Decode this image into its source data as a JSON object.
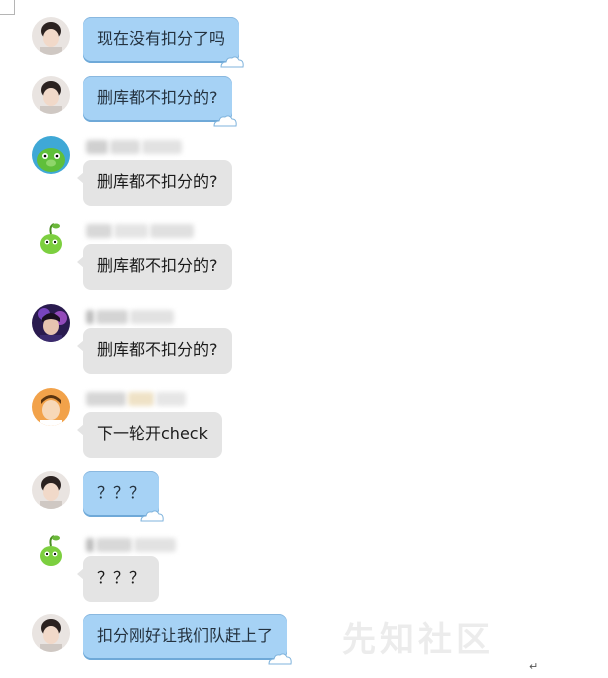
{
  "messages": [
    {
      "id": "m1",
      "side": "self",
      "avatar": "avatar-user-icon",
      "text": "现在没有扣分了吗"
    },
    {
      "id": "m2",
      "side": "self",
      "avatar": "avatar-user-icon",
      "text": "删库都不扣分的?"
    },
    {
      "id": "m3",
      "side": "other",
      "avatar": "green-pig-avatar-icon",
      "text": "删库都不扣分的?"
    },
    {
      "id": "m4",
      "side": "other",
      "avatar": "green-character-avatar-icon",
      "text": "删库都不扣分的?"
    },
    {
      "id": "m5",
      "side": "other",
      "avatar": "purple-avatar-icon",
      "text": "删库都不扣分的?"
    },
    {
      "id": "m6",
      "side": "other",
      "avatar": "orange-avatar-icon",
      "text": "下一轮开check"
    },
    {
      "id": "m7",
      "side": "self",
      "avatar": "avatar-user-icon",
      "text": "？？？"
    },
    {
      "id": "m8",
      "side": "other",
      "avatar": "green-character-avatar-icon",
      "text": "？？？"
    },
    {
      "id": "m9",
      "side": "self",
      "avatar": "avatar-user-icon",
      "text": "扣分刚好让我们队赶上了"
    }
  ],
  "watermark": {
    "text": "先知社区"
  },
  "return_mark": "↵",
  "colors": {
    "self_bubble": "#a6d2f5",
    "other_bubble": "#e4e4e4"
  }
}
